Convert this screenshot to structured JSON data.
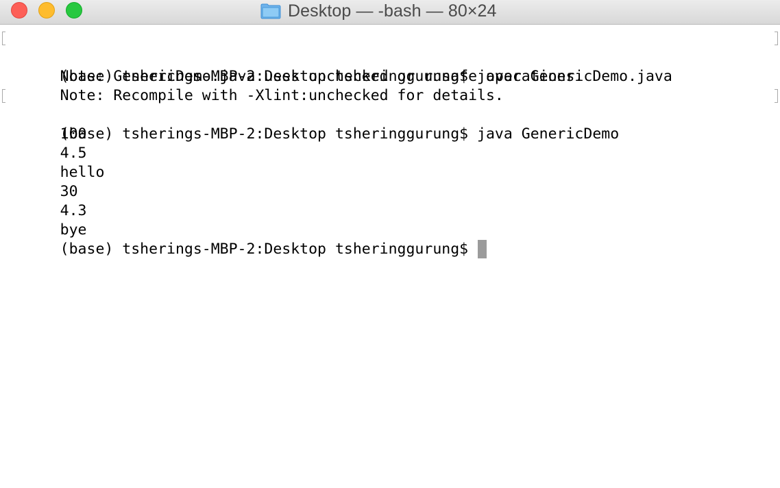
{
  "window": {
    "title": "Desktop — -bash — 80×24",
    "title_icon": "folder-icon",
    "buttons": {
      "close": "close-button",
      "minimize": "minimize-button",
      "zoom": "zoom-button"
    },
    "colors": {
      "close": "#fd5f57",
      "minimize": "#febc2e",
      "zoom": "#28c840",
      "cursor": "#9b9b9b"
    }
  },
  "terminal": {
    "lines": [
      "(base) tsherings-MBP-2:Desktop tsheringgurung$ javac GenericDemo.java",
      "Note: GenericDemo.java uses unchecked or unsafe operations.",
      "Note: Recompile with -Xlint:unchecked for details.",
      "(base) tsherings-MBP-2:Desktop tsheringgurung$ java GenericDemo",
      "100",
      "4.5",
      "hello",
      "30",
      "4.3",
      "bye"
    ],
    "current_prompt": "(base) tsherings-MBP-2:Desktop tsheringgurung$ "
  }
}
